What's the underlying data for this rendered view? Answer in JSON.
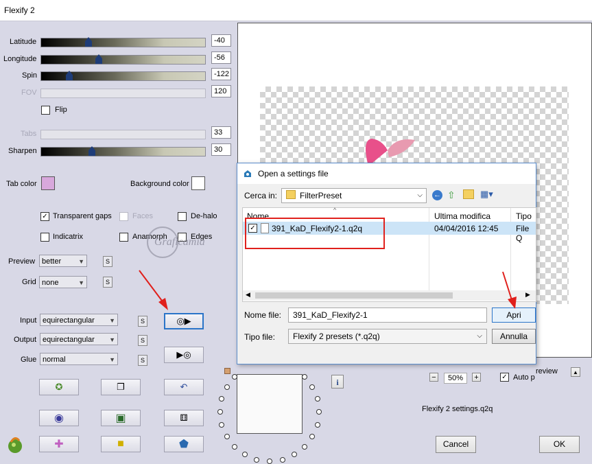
{
  "window": {
    "title": "Flexify 2"
  },
  "sliders": [
    {
      "label": "Latitude",
      "value": "-40",
      "fraction": 0.29,
      "disabled": false
    },
    {
      "label": "Longitude",
      "value": "-56",
      "fraction": 0.35,
      "disabled": false
    },
    {
      "label": "Spin",
      "value": "-122",
      "fraction": 0.17,
      "disabled": false
    },
    {
      "label": "FOV",
      "value": "120",
      "fraction": null,
      "disabled": true
    },
    {
      "label": "Tabs",
      "value": "33",
      "fraction": null,
      "disabled": true
    },
    {
      "label": "Sharpen",
      "value": "30",
      "fraction": 0.31,
      "disabled": false
    }
  ],
  "flip": {
    "label": "Flip",
    "checked": false
  },
  "tab_color": {
    "label": "Tab color",
    "color": "#d8a8dc"
  },
  "background_color": {
    "label": "Background color",
    "color": "#ffffff"
  },
  "options": {
    "transparent_gaps": {
      "label": "Transparent gaps",
      "checked": true
    },
    "faces": {
      "label": "Faces",
      "checked": false
    },
    "de_halo": {
      "label": "De-halo",
      "checked": false
    },
    "indicatrix": {
      "label": "Indicatrix",
      "checked": false
    },
    "anamorph": {
      "label": "Anamorph",
      "checked": false
    },
    "edges": {
      "label": "Edges",
      "checked": false
    }
  },
  "preview_select": {
    "label": "Preview",
    "value": "better"
  },
  "grid_select": {
    "label": "Grid",
    "value": "none"
  },
  "input_select": {
    "label": "Input",
    "value": "equirectangular"
  },
  "output_select": {
    "label": "Output",
    "value": "equirectangular"
  },
  "glue_select": {
    "label": "Glue",
    "value": "normal"
  },
  "s_button": "S",
  "info_button": "i",
  "zoom": {
    "minus": "−",
    "value": "50%",
    "plus": "+"
  },
  "auto_preview": {
    "label": "Auto p",
    "label_tail": "review",
    "checked": true
  },
  "settings_file": "Flexify 2 settings.q2q",
  "cancel_label": "Cancel",
  "ok_label": "OK",
  "watermark": "Graficamia",
  "dialog": {
    "title": "Open a settings file",
    "look_in_label": "Cerca in:",
    "look_in_value": "FilterPreset",
    "columns": {
      "name": "Nome",
      "modified": "Ultima modifica",
      "type": "Tipo"
    },
    "file": {
      "name": "391_KaD_Flexify2-1.q2q",
      "modified": "04/04/2016 12:45",
      "type": "File Q",
      "checked": true
    },
    "filename_label": "Nome file:",
    "filename_value": "391_KaD_Flexify2-1",
    "filetype_label": "Tipo file:",
    "filetype_value": "Flexify 2 presets (*.q2q)",
    "open_label": "Apri",
    "cancel_label": "Annulla"
  },
  "colors": {
    "accent_red": "#e0201c",
    "highlight_blue": "#2a74c8",
    "tab_color": "#d8a8dc"
  }
}
